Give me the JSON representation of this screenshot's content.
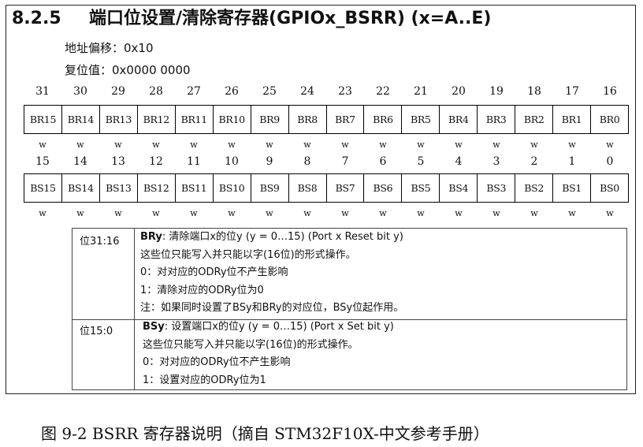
{
  "section": {
    "number": "8.2.5",
    "title": "端口位设置/清除寄存器(GPIOx_BSRR) (x=A..E)"
  },
  "offset": {
    "label": "地址偏移：",
    "value": "0x10"
  },
  "reset_value": {
    "label": "复位值：",
    "value": "0x0000 0000"
  },
  "high_bits": {
    "numbers": [
      "31",
      "30",
      "29",
      "28",
      "27",
      "26",
      "25",
      "24",
      "23",
      "22",
      "21",
      "20",
      "19",
      "18",
      "17",
      "16"
    ],
    "names": [
      "BR15",
      "BR14",
      "BR13",
      "BR12",
      "BR11",
      "BR10",
      "BR9",
      "BR8",
      "BR7",
      "BR6",
      "BR5",
      "BR4",
      "BR3",
      "BR2",
      "BR1",
      "BR0"
    ],
    "access": [
      "w",
      "w",
      "w",
      "w",
      "w",
      "w",
      "w",
      "w",
      "w",
      "w",
      "w",
      "w",
      "w",
      "w",
      "w",
      "w"
    ]
  },
  "low_bits": {
    "numbers": [
      "15",
      "14",
      "13",
      "12",
      "11",
      "10",
      "9",
      "8",
      "7",
      "6",
      "5",
      "4",
      "3",
      "2",
      "1",
      "0"
    ],
    "names": [
      "BS15",
      "BS14",
      "BS13",
      "BS12",
      "BS11",
      "BS10",
      "BS9",
      "BS8",
      "BS7",
      "BS6",
      "BS5",
      "BS4",
      "BS3",
      "BS2",
      "BS1",
      "BS0"
    ],
    "access": [
      "w",
      "w",
      "w",
      "w",
      "w",
      "w",
      "w",
      "w",
      "w",
      "w",
      "w",
      "w",
      "w",
      "w",
      "w",
      "w"
    ]
  },
  "descriptions": [
    {
      "range": "位31:16",
      "field": "BRy",
      "summary": ": 清除端口x的位y (y = 0…15) (Port x Reset bit y)",
      "lines": [
        "这些位只能写入并只能以字(16位)的形式操作。",
        "0：对对应的ODRy位不产生影响",
        "1：清除对应的ODRy位为0",
        "注：如果同时设置了BSy和BRy的对应位，BSy位起作用。"
      ]
    },
    {
      "range": "位15:0",
      "field": "BSy",
      "summary": ": 设置端口x的位y (y = 0…15) (Port x Set bit y)",
      "lines": [
        "这些位只能写入并只能以字(16位)的形式操作。",
        "0：对对应的ODRy位不产生影响",
        "1：设置对应的ODRy位为1"
      ]
    }
  ],
  "caption": "图 9-2 BSRR 寄存器说明（摘自 STM32F10X-中文参考手册）"
}
